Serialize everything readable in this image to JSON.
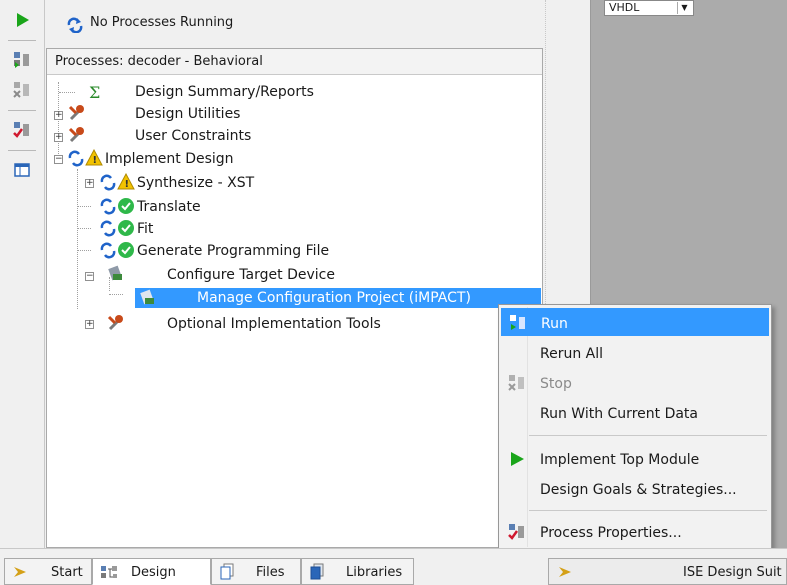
{
  "status": {
    "text": "No Processes Running"
  },
  "panel": {
    "title": "Processes: decoder - Behavioral"
  },
  "tree": [
    {
      "label": "Design Summary/Reports",
      "icon": "sigma-icon"
    },
    {
      "label": "Design Utilities",
      "icon": "tools-icon"
    },
    {
      "label": "User Constraints",
      "icon": "tools-icon"
    },
    {
      "label": "Implement Design",
      "icon": "warning-icon"
    },
    {
      "label": "Synthesize - XST",
      "icon": "warning-icon"
    },
    {
      "label": "Translate",
      "icon": "check-icon"
    },
    {
      "label": "Fit",
      "icon": "check-icon"
    },
    {
      "label": "Generate Programming File",
      "icon": "check-icon"
    },
    {
      "label": "Configure Target Device",
      "icon": "device-icon"
    },
    {
      "label": "Manage Configuration Project (iMPACT)",
      "icon": "device-icon",
      "selected": true
    },
    {
      "label": "Optional Implementation Tools",
      "icon": "tools-icon"
    }
  ],
  "context_menu": {
    "run": "Run",
    "rerun_all": "Rerun All",
    "stop": "Stop",
    "run_current": "Run With Current Data",
    "implement_top": "Implement Top Module",
    "design_goals": "Design Goals & Strategies...",
    "process_props": "Process Properties..."
  },
  "tabs": {
    "start": "Start",
    "design": "Design",
    "files": "Files",
    "libraries": "Libraries",
    "ise": "ISE Design Suit"
  },
  "editor": {
    "language": "VHDL"
  },
  "colors": {
    "selection": "#3399ff",
    "check": "#2fb84a",
    "warning": "#f2c200",
    "refresh": "#1f63c9",
    "play": "#1aa51a"
  }
}
